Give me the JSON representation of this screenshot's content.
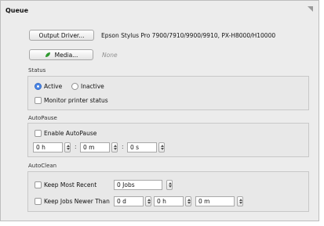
{
  "queue": {
    "title": "Queue",
    "output_driver_button": "Output Driver...",
    "driver_name": "Epson Stylus Pro 7900/7910/9900/9910, PX-H8000/H10000",
    "media_button": "Media...",
    "media_value": "None"
  },
  "status": {
    "label": "Status",
    "active_label": "Active",
    "inactive_label": "Inactive",
    "active_selected": true,
    "monitor_label": "Monitor printer status",
    "monitor_checked": false
  },
  "autopause": {
    "label": "AutoPause",
    "enable_label": "Enable AutoPause",
    "enable_checked": false,
    "hours": "0 h",
    "minutes": "0 m",
    "seconds": "0 s",
    "separator": ":"
  },
  "autoclean": {
    "label": "AutoClean",
    "keep_recent_label": "Keep Most Recent",
    "keep_recent_checked": false,
    "jobs_value": "0 Jobs",
    "keep_newer_label": "Keep Jobs Newer Than",
    "keep_newer_checked": false,
    "days_value": "0 d",
    "hours_value": "0 h",
    "minutes_value": "0 m"
  },
  "colors": {
    "panel_bg": "#ececec",
    "group_bg": "#e8e8e8",
    "radio_selected": "#3b7be0",
    "media_icon": "#2f9a2f"
  }
}
